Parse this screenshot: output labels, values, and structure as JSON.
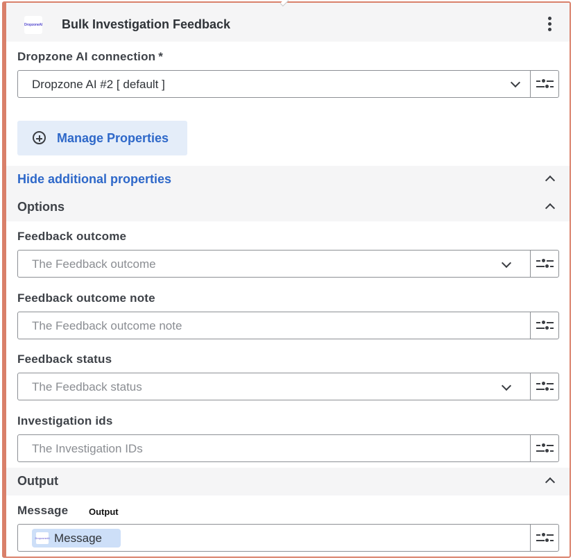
{
  "header": {
    "logo_text": "DropzoneAI",
    "title": "Bulk Investigation Feedback"
  },
  "connection": {
    "label": "Dropzone AI connection",
    "required_mark": "*",
    "value": "Dropzone AI #2 [ default ]"
  },
  "manage_properties": {
    "label": "Manage Properties"
  },
  "additional": {
    "toggle_label": "Hide additional properties"
  },
  "options": {
    "title": "Options",
    "fields": [
      {
        "label": "Feedback outcome",
        "placeholder": "The Feedback outcome",
        "type": "select"
      },
      {
        "label": "Feedback outcome note",
        "placeholder": "The Feedback outcome note",
        "type": "text"
      },
      {
        "label": "Feedback status",
        "placeholder": "The Feedback status",
        "type": "select"
      },
      {
        "label": "Investigation ids",
        "placeholder": "The Investigation IDs",
        "type": "text"
      }
    ]
  },
  "output": {
    "title": "Output",
    "message_label": "Message",
    "output_tag": "Output",
    "chip_logo_text": "DropzoneAI",
    "chip_label": "Message"
  },
  "icons": {
    "kebab": "kebab-menu-icon",
    "chevron": "chevron-down-icon",
    "collapse": "chevron-up-icon",
    "tune": "sliders-icon",
    "plus": "plus-circle-icon"
  },
  "colors": {
    "accent_border": "#d9806a",
    "link_blue": "#2e68c9",
    "button_bg": "#e4edf9",
    "chip_bg": "#cddff8"
  }
}
